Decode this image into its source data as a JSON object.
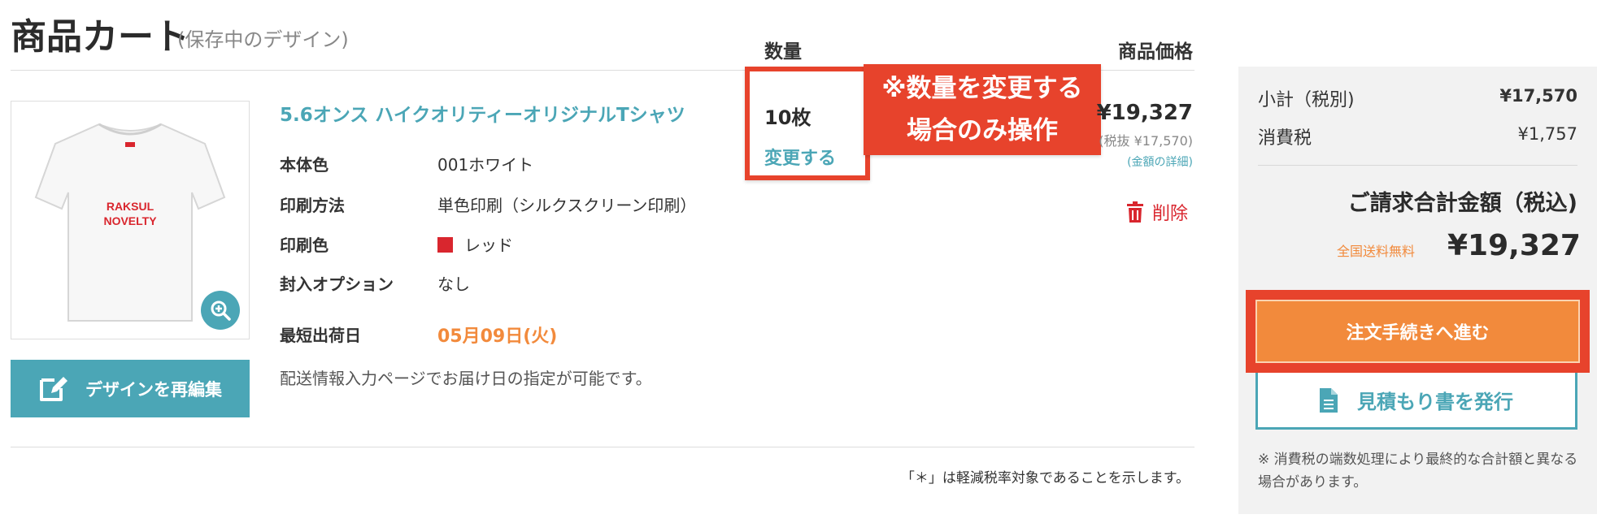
{
  "header": {
    "title": "商品カート",
    "subtitle": "(保存中のデザイン)",
    "col_quantity": "数量",
    "col_price": "商品価格"
  },
  "product": {
    "name": "5.6オンス ハイクオリティーオリジナルTシャツ",
    "shirt_print_line1": "RAKSUL",
    "shirt_print_line2": "NOVELTY",
    "specs": [
      {
        "label": "本体色",
        "value": "001ホワイト"
      },
      {
        "label": "印刷方法",
        "value": "単色印刷（シルクスクリーン印刷）"
      },
      {
        "label": "印刷色",
        "value": "レッド",
        "swatch_color": "#d9262e"
      },
      {
        "label": "封入オプション",
        "value": "なし"
      }
    ],
    "ship_label": "最短出荷日",
    "ship_date": "05月09日(火)",
    "ship_note": "配送情報入力ページでお届け日の指定が可能です。",
    "reedit_label": "デザインを再編集",
    "zoom_icon": "zoom-in-icon"
  },
  "quantity": {
    "value": "10枚",
    "change_label": "変更する",
    "callout_line1": "※数量を変更する",
    "callout_line2": "場合のみ操作"
  },
  "price": {
    "amount": "¥19,327",
    "tax_excluded": "(税抜 ¥17,570)",
    "detail_link": "(金額の詳細)",
    "delete_label": "削除"
  },
  "footnote": "「＊」は軽減税率対象であることを示します。",
  "summary": {
    "subtotal_label": "小計（税別)",
    "subtotal_value": "¥17,570",
    "tax_label": "消費税",
    "tax_value": "¥1,757",
    "total_label": "ご請求合計金額（税込)",
    "free_shipping": "全国送料無料",
    "total_value": "¥19,327",
    "checkout_label": "注文手続きへ進む",
    "estimate_label": "見積もり書を発行",
    "tax_note": "※ 消費税の端数処理により最終的な合計額と異なる場合があります。"
  },
  "colors": {
    "accent_teal": "#4ba6b6",
    "accent_orange": "#f28a3c",
    "highlight_red": "#e7432c",
    "delete_red": "#d9262e"
  }
}
